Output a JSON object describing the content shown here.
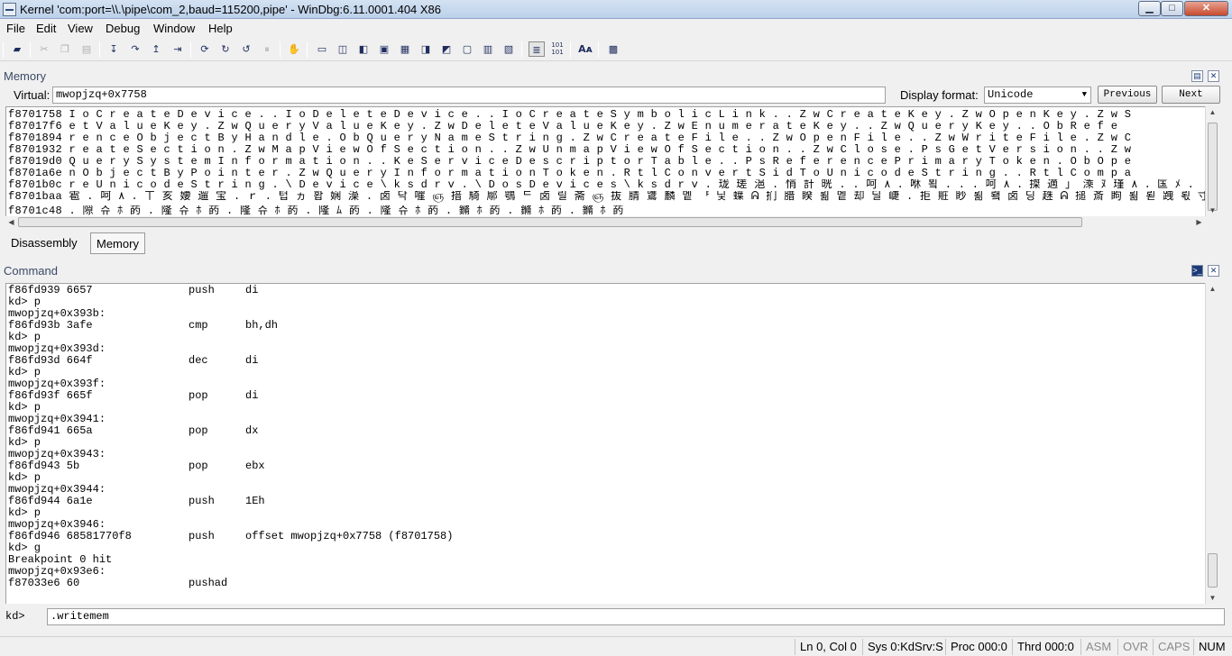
{
  "window": {
    "title": "Kernel 'com:port=\\\\.\\pipe\\com_2,baud=115200,pipe' - WinDbg:6.11.0001.404 X86",
    "min_glyph": "▁",
    "max_glyph": "□",
    "close_glyph": "✕"
  },
  "menu": [
    "File",
    "Edit",
    "View",
    "Debug",
    "Window",
    "Help"
  ],
  "toolbar_icons": [
    "open-icon",
    "cut-icon",
    "copy-icon",
    "paste-icon",
    "step-into-icon",
    "step-over-icon",
    "step-out-icon",
    "run-to-cursor-icon",
    "go-icon",
    "restart-icon",
    "stop-debugging-icon",
    "break-icon",
    "source-mode-icon",
    "command-window-icon",
    "watch-icon",
    "locals-icon",
    "registers-icon",
    "memory-icon",
    "call-stack-icon",
    "disassembly-icon",
    "scratch-pad-icon",
    "processes-icon",
    "source-mode-toggle-icon",
    "hex-display-icon",
    "font-icon",
    "options-icon"
  ],
  "memory": {
    "title": "Memory",
    "virtual_label": "Virtual:",
    "address": "mwopjzq+0x7758",
    "display_format_label": "Display format:",
    "display_format": "Unicode",
    "previous": "Previous",
    "next": "Next",
    "lines": [
      "f8701758 I o C r e a t e D e v i c e . . I o D e l e t e D e v i c e . . I o C r e a t e S y m b o l i c L i n k . . Z w C r e a t e K e y . Z w O p e n K e y . Z w S",
      "f87017f6 e t V a l u e K e y . Z w Q u e r y V a l u e K e y . Z w D e l e t e V a l u e K e y . Z w E n u m e r a t e K e y . . Z w Q u e r y K e y . . O b R e f e",
      "f8701894 r e n c e O b j e c t B y H a n d l e . O b Q u e r y N a m e S t r i n g . Z w C r e a t e F i l e . . Z w O p e n F i l e . . Z w W r i t e F i l e . Z w C",
      "f8701932 r e a t e S e c t i o n . Z w M a p V i e w O f S e c t i o n . . Z w U n m a p V i e w O f S e c t i o n . . Z w C l o s e . P s G e t V e r s i o n . . Z w",
      "f87019d0 Q u e r y S y s t e m I n f o r m a t i o n . . K e S e r v i c e D e s c r i p t o r T a b l e . . P s R e f e r e n c e P r i m a r y T o k e n . O b O p e",
      "f8701a6e n O b j e c t B y P o i n t e r . Z w Q u e r y I n f o r m a t i o n T o k e n . R t l C o n v e r t S i d T o U n i c o d e S t r i n g . . R t l C o m p a",
      "f8701b0c r e U n i c o d e S t r i n g . \\ D e v i c e \\ k s d r v . \\ D o s D e v i c e s \\ k s d r v . 珑 瑳 浥 . 悄 計 晄 . . 呵 ٨ . 咻 뵠 . . . 呵 ٨ . 搩 適 」 溗 ﾇ 瑾 ٨ . 匤 ﾒ .",
      "f8701baa 雹 . 呵 ٨ . ㄒ 亥 婹 遛 宝 . ｒ . 텁 ヵ 홥 娴 澡 . 卤 닥 嘊 ஞ 揞 騎 鄏 鶚 ᄃ 卤 릴 斋 ஞ 抜 腈 鷕 麟 멭 ᅣ 닟 蠂 ᕱ 扪 腊 睽 뢺 멭 却 딜 崨 . 拒 賍 眇 뢺 뢬 卤 딩 趎 ᕱ 搥 斎 眗 뢺 뢷 跩 뢳 寸 ∫ 扻 腏 睽 뢻",
      "f8701c48 . 隙 슈 ﾎ 菂 . 隆 슈 ﾎ 菂 . 隆 슈 ﾎ 菂 . 隆 ﾑ 菂 . 隆 슈 ﾎ 菂 . 鏅 ﾎ 菂 . 鏅 ﾎ 菂 . 鏅 ﾎ 菂"
    ]
  },
  "tabs": [
    "Disassembly",
    "Memory"
  ],
  "command": {
    "title": "Command",
    "lines": [
      [
        "f86fd939 6657",
        "push",
        "di"
      ],
      [
        "kd> p",
        "",
        ""
      ],
      [
        "mwopjzq+0x393b:",
        "",
        ""
      ],
      [
        "f86fd93b 3afe",
        "cmp",
        "bh,dh"
      ],
      [
        "kd> p",
        "",
        ""
      ],
      [
        "mwopjzq+0x393d:",
        "",
        ""
      ],
      [
        "f86fd93d 664f",
        "dec",
        "di"
      ],
      [
        "kd> p",
        "",
        ""
      ],
      [
        "mwopjzq+0x393f:",
        "",
        ""
      ],
      [
        "f86fd93f 665f",
        "pop",
        "di"
      ],
      [
        "kd> p",
        "",
        ""
      ],
      [
        "mwopjzq+0x3941:",
        "",
        ""
      ],
      [
        "f86fd941 665a",
        "pop",
        "dx"
      ],
      [
        "kd> p",
        "",
        ""
      ],
      [
        "mwopjzq+0x3943:",
        "",
        ""
      ],
      [
        "f86fd943 5b",
        "pop",
        "ebx"
      ],
      [
        "kd> p",
        "",
        ""
      ],
      [
        "mwopjzq+0x3944:",
        "",
        ""
      ],
      [
        "f86fd944 6a1e",
        "push",
        "1Eh"
      ],
      [
        "kd> p",
        "",
        ""
      ],
      [
        "mwopjzq+0x3946:",
        "",
        ""
      ],
      [
        "f86fd946 68581770f8",
        "push",
        "offset mwopjzq+0x7758 (f8701758)"
      ],
      [
        "kd> g",
        "",
        ""
      ],
      [
        "Breakpoint 0 hit",
        "",
        ""
      ],
      [
        "mwopjzq+0x93e6:",
        "",
        ""
      ],
      [
        "f87033e6 60",
        "pushad",
        ""
      ]
    ],
    "prompt": "kd>",
    "input": ".writemem"
  },
  "status": {
    "position": "Ln 0, Col 0",
    "sys": "Sys 0:KdSrv:S",
    "proc": "Proc 000:0",
    "thrd": "Thrd 000:0",
    "asm": "ASM",
    "ovr": "OVR",
    "caps": "CAPS",
    "num": "NUM"
  }
}
